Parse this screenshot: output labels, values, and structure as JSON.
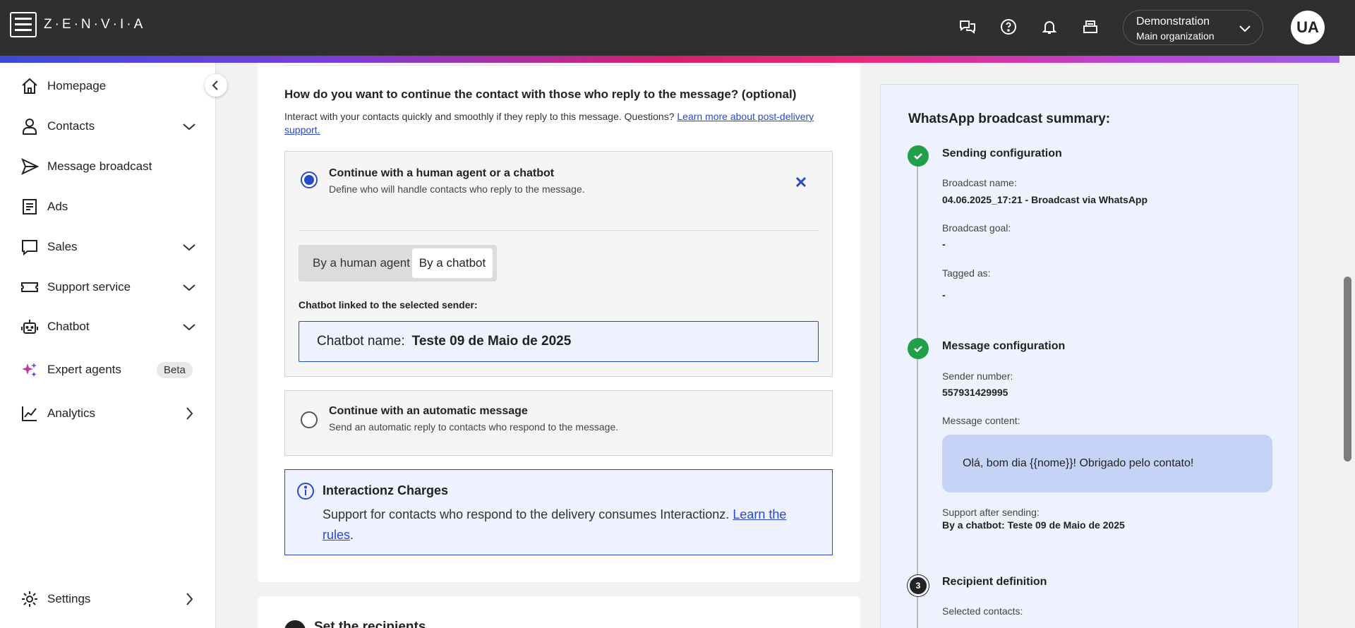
{
  "app": {
    "logo_text": "Z·E·N·V·I·A"
  },
  "header": {
    "icons": [
      "chat-question-icon",
      "help-icon",
      "bell-icon",
      "inbox-icon"
    ],
    "org": {
      "name": "Demonstration",
      "sub": "Main organization"
    },
    "avatar": "UA"
  },
  "sidebar": {
    "items": [
      {
        "label": "Homepage",
        "icon": "home-icon"
      },
      {
        "label": "Contacts",
        "icon": "person-icon",
        "expand": "down"
      },
      {
        "label": "Message broadcast",
        "icon": "send-icon"
      },
      {
        "label": "Ads",
        "icon": "document-icon"
      },
      {
        "label": "Sales",
        "icon": "speech-bubble-icon",
        "expand": "down"
      },
      {
        "label": "Support service",
        "icon": "ticket-icon",
        "expand": "down"
      },
      {
        "label": "Chatbot",
        "icon": "robot-icon",
        "expand": "down"
      },
      {
        "label": "Expert agents",
        "icon": "sparkle-icon",
        "badge": "Beta"
      },
      {
        "label": "Analytics",
        "icon": "chart-icon",
        "expand": "right"
      }
    ],
    "settings": "Settings"
  },
  "main": {
    "question_title": "How do you want to continue the contact with those who reply to the message? (optional)",
    "question_sub": "Interact with your contacts quickly and smoothly if they reply to this message. Questions? ",
    "question_link": "Learn more about post-delivery support.",
    "option1": {
      "title": "Continue with a human agent or a chatbot",
      "desc": "Define who will handle contacts who reply to the message.",
      "selected": true,
      "tabs": [
        "By a human agent",
        "By a chatbot"
      ],
      "active_tab": "By a chatbot",
      "field_label": "Chatbot linked to the selected sender:",
      "chatbot_key": "Chatbot name:",
      "chatbot_value": "Teste 09 de Maio de 2025"
    },
    "option2": {
      "title": "Continue with an automatic message",
      "desc": "Send an automatic reply to contacts who respond to the message.",
      "selected": false
    },
    "info": {
      "title": "Interactionz Charges",
      "body": "Support for contacts who respond to the delivery consumes Interactionz. ",
      "link": "Learn the rules",
      "tail": "."
    },
    "next_section_title": "Set the recipients"
  },
  "summary": {
    "title": "WhatsApp broadcast summary:",
    "step1": {
      "title": "Sending configuration",
      "name_label": "Broadcast name:",
      "name_value": "04.06.2025_17:21 - Broadcast via WhatsApp",
      "goal_label": "Broadcast goal:",
      "goal_value": "-",
      "tag_label": "Tagged as:",
      "tag_value": "-"
    },
    "step2": {
      "title": "Message configuration",
      "sender_label": "Sender number:",
      "sender_value": "557931429995",
      "content_label": "Message content:",
      "content_value": "Olá, bom dia {{nome}}! Obrigado pelo contato!",
      "support_label": "Support after sending:",
      "support_value": "By a chatbot: Teste 09 de Maio de 2025"
    },
    "step3": {
      "number": "3",
      "title": "Recipient definition",
      "contacts_label": "Selected contacts:"
    }
  },
  "colors": {
    "accent": "#2a49c9",
    "success": "#22a049",
    "topbar": "#2f2f2f",
    "summary_bg": "#eef2ff"
  }
}
